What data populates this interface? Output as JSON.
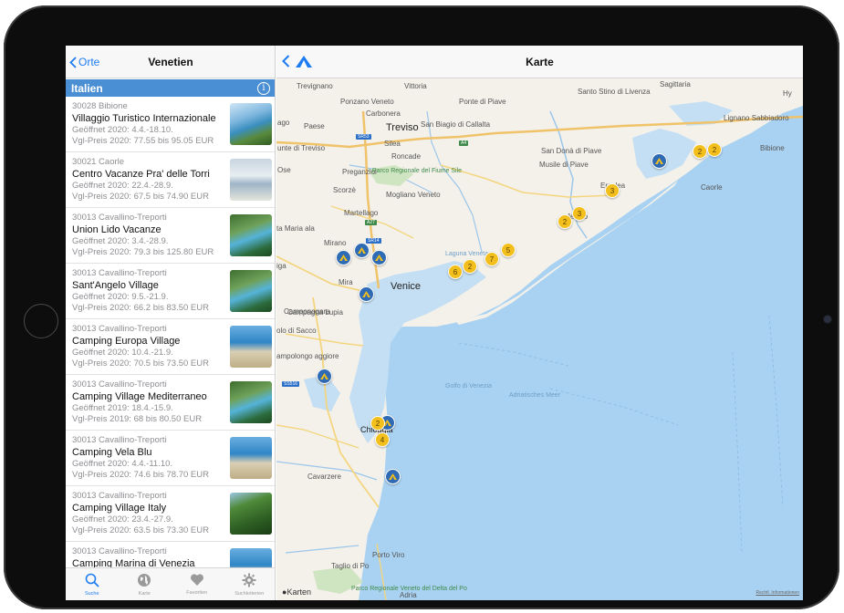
{
  "sidebar": {
    "back_label": "Orte",
    "title": "Venetien",
    "section_title": "Italien",
    "info_glyph": "i",
    "items": [
      {
        "zip": "30028 Bibione",
        "name": "Villaggio Turistico Internazionale",
        "opened": "Geöffnet 2020: 4.4.-18.10.",
        "price": "Vgl-Preis 2020: 77.55 bis 95.05 EUR",
        "thumb": "resort-pools"
      },
      {
        "zip": "30021 Caorle",
        "name": "Centro Vacanze Pra' delle Torri",
        "opened": "Geöffnet 2020: 22.4.-28.9.",
        "price": "Vgl-Preis 2020: 67.5 bis 74.90 EUR",
        "thumb": "resort-aerial"
      },
      {
        "zip": "30013 Cavallino-Treporti",
        "name": "Union Lido Vacanze",
        "opened": "Geöffnet 2020: 3.4.-28.9.",
        "price": "Vgl-Preis 2020: 79.3 bis 125.80 EUR",
        "thumb": "pool-park"
      },
      {
        "zip": "30013 Cavallino-Treporti",
        "name": "Sant'Angelo Village",
        "opened": "Geöffnet 2020: 9.5.-21.9.",
        "price": "Vgl-Preis 2020: 66.2 bis 83.50 EUR",
        "thumb": "pool-park"
      },
      {
        "zip": "30013 Cavallino-Treporti",
        "name": "Camping Europa Village",
        "opened": "Geöffnet 2020: 10.4.-21.9.",
        "price": "Vgl-Preis 2020: 70.5 bis 73.50 EUR",
        "thumb": "beach"
      },
      {
        "zip": "30013 Cavallino-Treporti",
        "name": "Camping Village Mediterraneo",
        "opened": "Geöffnet 2019: 18.4.-15.9.",
        "price": "Vgl-Preis 2019: 68 bis 80.50 EUR",
        "thumb": "pool-park"
      },
      {
        "zip": "30013 Cavallino-Treporti",
        "name": "Camping Vela Blu",
        "opened": "Geöffnet 2020: 4.4.-11.10.",
        "price": "Vgl-Preis 2020: 74.6 bis 78.70 EUR",
        "thumb": "beach"
      },
      {
        "zip": "30013 Cavallino-Treporti",
        "name": "Camping Village Italy",
        "opened": "Geöffnet 2020: 23.4.-27.9.",
        "price": "Vgl-Preis 2020: 63.5 bis 73.30 EUR",
        "thumb": "forest"
      },
      {
        "zip": "30013 Cavallino-Treporti",
        "name": "Camping Marina di Venezia",
        "opened": "",
        "price": "",
        "thumb": "beach"
      }
    ],
    "tabs": [
      {
        "label": "Suche",
        "icon": "search-icon",
        "active": true
      },
      {
        "label": "Karte",
        "icon": "globe-icon",
        "active": false
      },
      {
        "label": "Favoriten",
        "icon": "heart-icon",
        "active": false
      },
      {
        "label": "Suchkriterien",
        "icon": "gear-icon",
        "active": false
      }
    ]
  },
  "map": {
    "title": "Karte",
    "credit": "Karten",
    "legal": "Rechtl. Informationen",
    "labels": [
      {
        "text": "Trevignano"
      },
      {
        "text": "Vittoria"
      },
      {
        "text": "Ponzano Veneto"
      },
      {
        "text": "Ponte di Piave"
      },
      {
        "text": "Santo Stino di Livenza"
      },
      {
        "text": "Sagittaria"
      },
      {
        "text": "Hy"
      },
      {
        "text": "Carbonera"
      },
      {
        "text": "Paese"
      },
      {
        "text": "Treviso"
      },
      {
        "text": "San Biagio di Callalta"
      },
      {
        "text": "Silea"
      },
      {
        "text": "Lignano Sabbiadoro"
      },
      {
        "text": "Bibione"
      },
      {
        "text": "Roncade"
      },
      {
        "text": "San Donà di Piave"
      },
      {
        "text": "Musile di Piave"
      },
      {
        "text": "Preganziol"
      },
      {
        "text": "Parco Regionale del Fiume Sile"
      },
      {
        "text": "Caorle"
      },
      {
        "text": "Eraclea"
      },
      {
        "text": "Mogliano Veneto"
      },
      {
        "text": "Scorzè"
      },
      {
        "text": "Martellago"
      },
      {
        "text": "Jesolo"
      },
      {
        "text": "Mirano"
      },
      {
        "text": "Laguna Veneta"
      },
      {
        "text": "Venice"
      },
      {
        "text": "Mira"
      },
      {
        "text": "Campagna Lupia"
      },
      {
        "text": "Golfo di Venezia"
      },
      {
        "text": "Adriatisches Meer"
      },
      {
        "text": "Chioggia"
      },
      {
        "text": "Cavarzere"
      },
      {
        "text": "Porto Viro"
      },
      {
        "text": "Taglio di Po"
      },
      {
        "text": "Adria"
      },
      {
        "text": "Parco Regionale Veneto del Delta del Po"
      },
      {
        "text": "ago"
      },
      {
        "text": "unte di Treviso"
      },
      {
        "text": "Ose"
      },
      {
        "text": "ta Maria ala"
      },
      {
        "text": "iga"
      },
      {
        "text": "Camponogara"
      },
      {
        "text": "olo di Sacco"
      },
      {
        "text": "ampolongo aggiore"
      }
    ],
    "clusters": [
      {
        "count": "2"
      },
      {
        "count": "2"
      },
      {
        "count": "3"
      },
      {
        "count": "2"
      },
      {
        "count": "3"
      },
      {
        "count": "6"
      },
      {
        "count": "2"
      },
      {
        "count": "7"
      },
      {
        "count": "5"
      },
      {
        "count": "2"
      },
      {
        "count": "4"
      }
    ],
    "highways": [
      {
        "text": "SR53"
      },
      {
        "text": "A4"
      },
      {
        "text": "A27"
      },
      {
        "text": "SR14"
      },
      {
        "text": "SS516"
      }
    ]
  },
  "colors": {
    "accent": "#1e7cf2",
    "section": "#4a8fd4",
    "pin": "#2f6bb4",
    "cluster": "#f3bf1c",
    "water": "#a9d2f2",
    "land": "#f3f1ea",
    "lagoon": "#c4dff3"
  }
}
